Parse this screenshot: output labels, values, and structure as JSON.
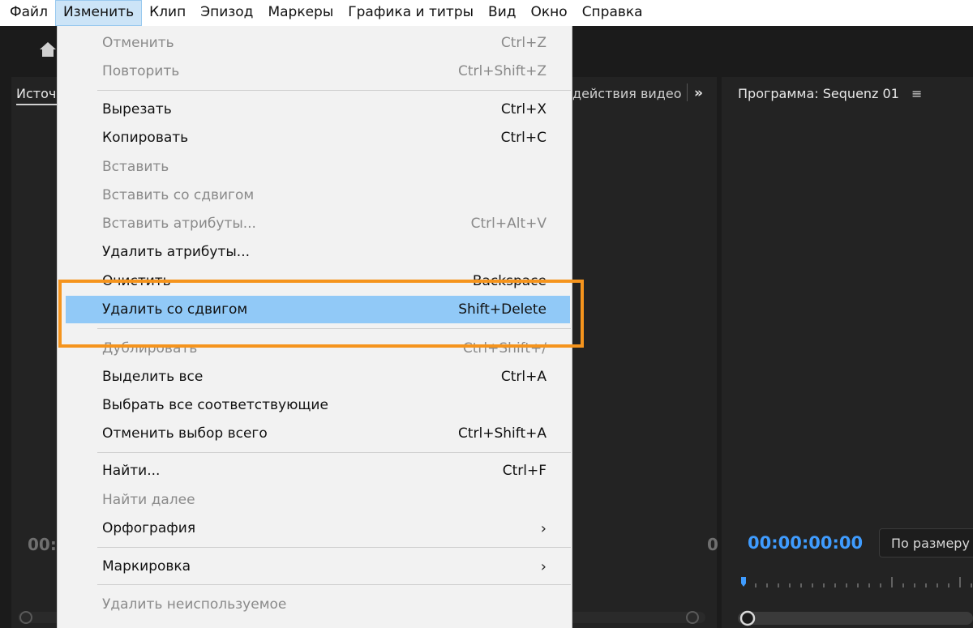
{
  "menubar": {
    "items": [
      "Файл",
      "Изменить",
      "Клип",
      "Эпизод",
      "Маркеры",
      "Графика и титры",
      "Вид",
      "Окно",
      "Справка"
    ]
  },
  "panels": {
    "source_tab": "Источ",
    "effects_tab": "действия видео",
    "chevrons": "»",
    "program_title": "Программа: Sequenz 01",
    "program_menu": "≡",
    "source_timecode": "00:",
    "source_timecode_right": "0",
    "program_timecode": "00:00:00:00",
    "fit_select_value": "По размеру к"
  },
  "edit_menu": {
    "undo": {
      "label": "Отменить",
      "shortcut": "Ctrl+Z"
    },
    "redo": {
      "label": "Повторить",
      "shortcut": "Ctrl+Shift+Z"
    },
    "cut": {
      "label": "Вырезать",
      "shortcut": "Ctrl+X"
    },
    "copy": {
      "label": "Копировать",
      "shortcut": "Ctrl+C"
    },
    "paste": {
      "label": "Вставить",
      "shortcut": ""
    },
    "paste_insert": {
      "label": "Вставить со сдвигом",
      "shortcut": ""
    },
    "paste_attributes": {
      "label": "Вставить атрибуты...",
      "shortcut": "Ctrl+Alt+V"
    },
    "remove_attributes": {
      "label": "Удалить атрибуты...",
      "shortcut": ""
    },
    "clear": {
      "label": "Очистить",
      "shortcut": "Backspace"
    },
    "ripple_delete": {
      "label": "Удалить со сдвигом",
      "shortcut": "Shift+Delete"
    },
    "duplicate": {
      "label": "Дублировать",
      "shortcut": "Ctrl+Shift+/"
    },
    "select_all": {
      "label": "Выделить все",
      "shortcut": "Ctrl+A"
    },
    "select_all_matching": {
      "label": "Выбрать все соответствующие",
      "shortcut": ""
    },
    "deselect_all": {
      "label": "Отменить выбор всего",
      "shortcut": "Ctrl+Shift+A"
    },
    "find": {
      "label": "Найти...",
      "shortcut": "Ctrl+F"
    },
    "find_next": {
      "label": "Найти далее",
      "shortcut": ""
    },
    "spelling": {
      "label": "Орфография",
      "shortcut": "›"
    },
    "labels": {
      "label": "Маркировка",
      "shortcut": "›"
    },
    "remove_unused": {
      "label": "Удалить неиспользуемое",
      "shortcut": ""
    }
  },
  "colors": {
    "menu_bg": "#f2f2f2",
    "highlight_row": "#91c9f7",
    "annotation_box": "#f5941d",
    "timecode_blue": "#3f9cff"
  }
}
